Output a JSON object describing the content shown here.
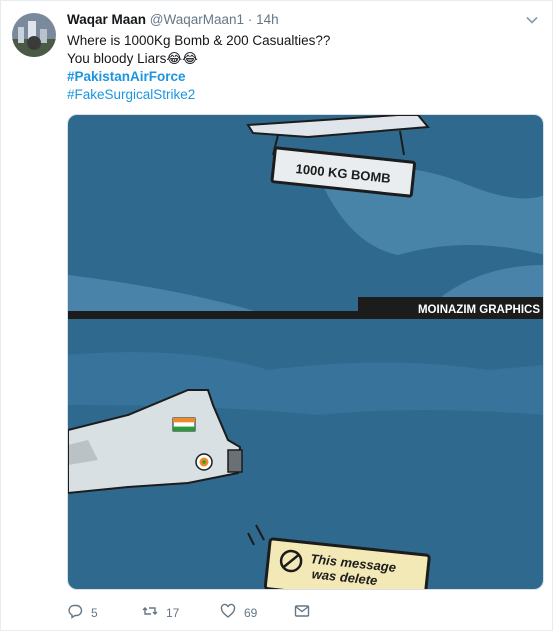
{
  "user": {
    "name": "Waqar Maan",
    "handle": "@WaqarMaan1",
    "separator": "·",
    "time": "14h"
  },
  "tweet": {
    "line1": "Where is 1000Kg Bomb & 200  Casualties??",
    "line2": "You bloody Liars😂😂",
    "hashtag1": "#PakistanAirForce",
    "hashtag2": "#FakeSurgicalStrike2"
  },
  "media": {
    "bomb_label": "1000 KG BOMB",
    "watermark": "MOINAZIM GRAPHICS",
    "sign_line1": "This message",
    "sign_line2": "was delete"
  },
  "actions": {
    "replies": "5",
    "retweets": "17",
    "likes": "69"
  },
  "colors": {
    "sky": "#2f6a8e",
    "cloud": "#6fa7c8",
    "link": "#1b95e0",
    "muted": "#657786"
  }
}
